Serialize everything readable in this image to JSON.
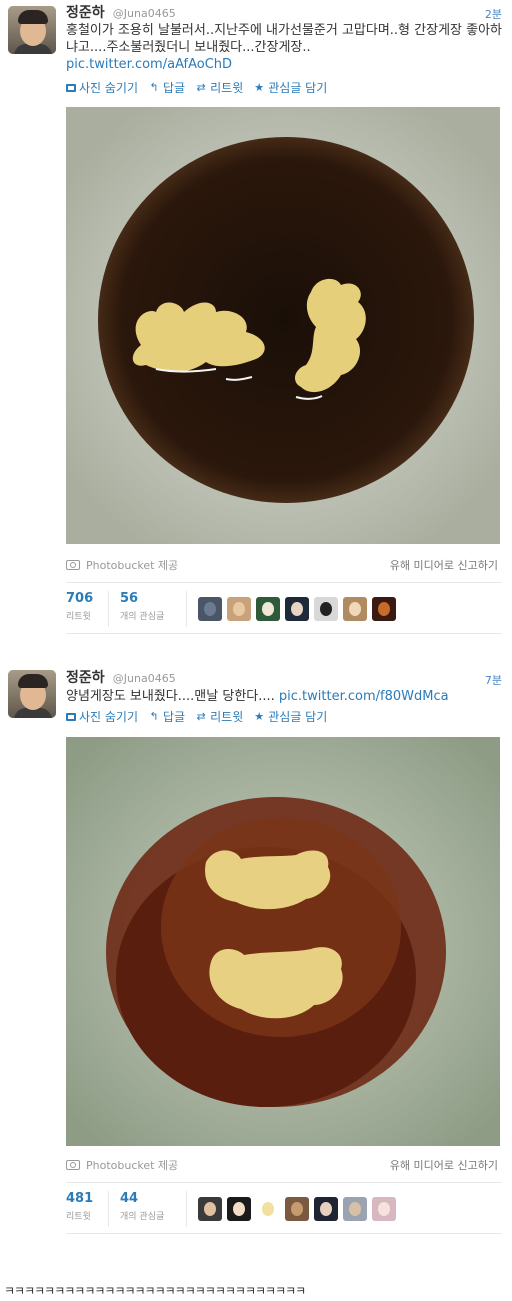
{
  "tweets": [
    {
      "name": "정준하",
      "handle": "@Juna0465",
      "time": "2분",
      "text": "홍철이가 조용히 날불러서..지난주에 내가선물준거 고맙다며..형 간장게장 좋아하냐고....주소불러줬더니 보내줬다...간장게장..",
      "link": "pic.twitter.com/aAfAoChD",
      "actions": {
        "hide_photo": "사진 숨기기",
        "reply": "답글",
        "retweet": "리트윗",
        "favorite": "관심글 담기"
      },
      "provider": "Photobucket 제공",
      "report": "유해 미디어로 신고하기",
      "retweets": {
        "count": "706",
        "label": "리트윗"
      },
      "favorites": {
        "count": "56",
        "label": "개의 관심글"
      }
    },
    {
      "name": "정준하",
      "handle": "@Juna0465",
      "time": "7분",
      "text": "양념게장도 보내줬다....맨날 당한다....",
      "link": "pic.twitter.com/f80WdMca",
      "actions": {
        "hide_photo": "사진 숨기기",
        "reply": "답글",
        "retweet": "리트윗",
        "favorite": "관심글 담기"
      },
      "provider": "Photobucket 제공",
      "report": "유해 미디어로 신고하기",
      "retweets": {
        "count": "481",
        "label": "리트윗"
      },
      "favorites": {
        "count": "44",
        "label": "개의 관심글"
      }
    }
  ],
  "footer_text": "ㅋㅋㅋㅋㅋㅋㅋㅋㅋㅋㅋㅋㅋㅋㅋㅋㅋㅋㅋㅋㅋㅋㅋㅋㅋㅋㅋㅋㅋㅋ",
  "colors": {
    "link": "#2b7bb9",
    "muted": "#999999",
    "text": "#333333"
  },
  "icons": [
    "photo-box-icon",
    "reply-arrow-icon",
    "retweet-icon",
    "star-icon",
    "camera-icon"
  ]
}
